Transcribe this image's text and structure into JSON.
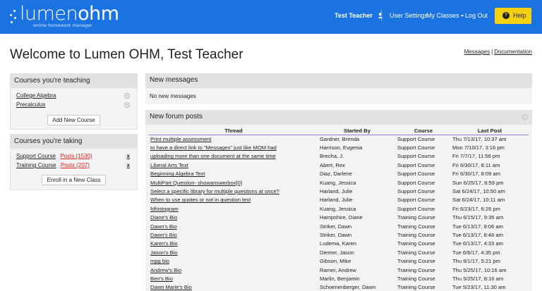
{
  "header": {
    "logo_text_a": "lumen",
    "logo_text_b": "ohm",
    "logo_sub": "online homework manager",
    "user_name": "Test Teacher",
    "user_settings": "User Settings",
    "my_classes": "My Classes",
    "logout": "Log Out",
    "help": "Help",
    "colors": {
      "bar": "#1a73e0",
      "help": "#f5d10f"
    }
  },
  "page": {
    "title": "Welcome to Lumen OHM, Test Teacher",
    "link_messages": "Messages",
    "link_separator": "|",
    "link_documentation": "Documentation"
  },
  "teaching": {
    "heading": "Courses you're teaching",
    "courses": [
      "College Algebra",
      "Precalculus"
    ],
    "add_button": "Add New Course"
  },
  "taking": {
    "heading": "Courses you're taking",
    "courses": [
      {
        "name": "Support Course",
        "posts": "Posts (1530)",
        "remove": "x"
      },
      {
        "name": "Training Course",
        "posts": "Posts (207)",
        "remove": "x"
      }
    ],
    "enroll_button": "Enroll in a New Class"
  },
  "messages": {
    "heading": "New messages",
    "empty_text": "No new messages"
  },
  "forum": {
    "heading": "New forum posts",
    "columns": [
      "Thread",
      "Started By",
      "Course",
      "Last Post"
    ],
    "rows": [
      [
        "Print multiple assessment",
        "Gardner, Brenda",
        "Support Course",
        "Thu 7/13/17, 10:37 am"
      ],
      [
        "to have a direct link to \"Messages\" just like MOM had",
        "Harrison, Evgenia",
        "Support Course",
        "Mon 7/10/17, 3:16 pm"
      ],
      [
        "uploading more than one document at the same time",
        "Brecha, J.",
        "Support Course",
        "Fri 7/7/17, 11:56 pm"
      ],
      [
        "Liberal Arts Text",
        "Abert, Rex",
        "Support Course",
        "Fri 6/30/17, 8:11 am"
      ],
      [
        "Beginning Algebra Text",
        "Diaz, Darlene",
        "Support Course",
        "Fri 6/30/17, 8:09 am"
      ],
      [
        "MultiPart Question- showanswerbox[0]",
        "Kuang, Jessica",
        "Support Course",
        "Sun 6/25/17, 8:59 pm"
      ],
      [
        "Select a specific library for multiple questions at once?",
        "Harland, Julie",
        "Support Course",
        "Sat 6/24/17, 10:50 am"
      ],
      [
        "When to use quotes or not in question text",
        "Harland, Julie",
        "Support Course",
        "Sat 6/24/17, 10:11 am"
      ],
      [
        "fdhistogram",
        "Kuang, Jessica",
        "Support Course",
        "Fri 6/23/17, 6:26 pm"
      ],
      [
        "Diane's Bio",
        "Hampshire, Diane",
        "Training Course",
        "Thu 6/15/17, 9:35 am"
      ],
      [
        "Dawn's Bio",
        "Striker, Dawn",
        "Training Course",
        "Tue 6/13/17, 9:06 am"
      ],
      [
        "Dawn's Bio",
        "Striker, Dawn",
        "Training Course",
        "Tue 6/13/17, 8:48 am"
      ],
      [
        "Karen's Bio",
        "Ludema, Karen",
        "Training Course",
        "Tue 6/13/17, 4:33 am"
      ],
      [
        "Jason's Bio",
        "Diemer, Jason",
        "Training Course",
        "Tue 6/6/17, 4:35 pm"
      ],
      [
        "mpg bio",
        "Gibson, Mike",
        "Training Course",
        "Thu 6/1/17, 5:21 pm"
      ],
      [
        "Andrew's Bio",
        "Ramer, Andrew",
        "Training Course",
        "Thu 5/25/17, 10:16 am"
      ],
      [
        "Ben's Bio",
        "Marlin, Benjamin",
        "Training Course",
        "Thu 5/25/17, 8:16 am"
      ],
      [
        "Dawn Marie's Bio",
        "Schoenenberger, Dawn",
        "Training Course",
        "Tue 5/23/17, 11:30 am"
      ]
    ]
  }
}
